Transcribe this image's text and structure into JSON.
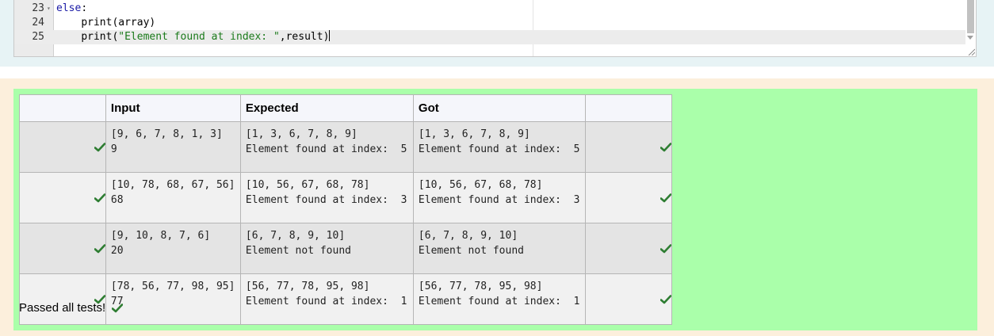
{
  "editor": {
    "lines": [
      {
        "number": "23",
        "fold": "▾",
        "indent": "",
        "keyword": "else",
        "rest": ":"
      },
      {
        "number": "24",
        "fold": "",
        "indent": "    ",
        "func": "print",
        "args": "(array)"
      },
      {
        "number": "25",
        "fold": "",
        "indent": "    ",
        "func": "print",
        "open": "(",
        "string": "\"Element found at index: \"",
        "tail": ",result)"
      }
    ]
  },
  "results": {
    "headers": {
      "input": "Input",
      "expected": "Expected",
      "got": "Got"
    },
    "rows": [
      {
        "input": [
          "[9, 6, 7, 8, 1, 3]",
          "9"
        ],
        "expected": [
          "[1, 3, 6, 7, 8, 9]",
          "Element found at index:  5"
        ],
        "got": [
          "[1, 3, 6, 7, 8, 9]",
          "Element found at index:  5"
        ]
      },
      {
        "input": [
          "[10, 78, 68, 67, 56]",
          "68"
        ],
        "expected": [
          "[10, 56, 67, 68, 78]",
          "Element found at index:  3"
        ],
        "got": [
          "[10, 56, 67, 68, 78]",
          "Element found at index:  3"
        ]
      },
      {
        "input": [
          "[9, 10, 8, 7, 6]",
          "20"
        ],
        "expected": [
          "[6, 7, 8, 9, 10]",
          "Element not found"
        ],
        "got": [
          "[6, 7, 8, 9, 10]",
          "Element not found"
        ]
      },
      {
        "input": [
          "[78, 56, 77, 98, 95]",
          "77"
        ],
        "expected": [
          "[56, 77, 78, 95, 98]",
          "Element found at index:  1"
        ],
        "got": [
          "[56, 77, 78, 95, 98]",
          "Element found at index:  1"
        ]
      }
    ],
    "passed_message": "Passed all tests!"
  },
  "colors": {
    "pass_green": "#aaffaa",
    "check_green": "#2e7d32"
  },
  "icons": {
    "row_status": "check-icon",
    "summary_status": "check-icon"
  }
}
